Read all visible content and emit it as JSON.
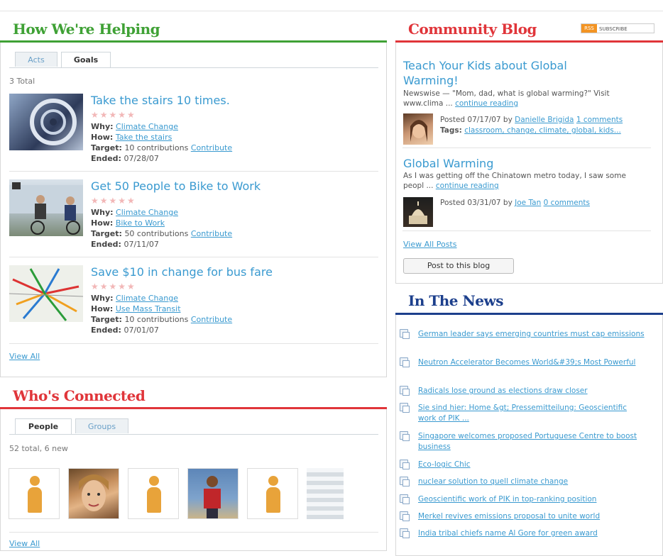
{
  "helping": {
    "heading": "How We're Helping",
    "tabs": [
      {
        "label": "Acts"
      },
      {
        "label": "Goals"
      }
    ],
    "total": "3 Total",
    "goals": [
      {
        "title": "Take the stairs 10 times.",
        "why_label": "Why:",
        "why": "Climate Change",
        "how_label": "How:",
        "how": "Take the stairs",
        "target_label": "Target:",
        "target": "10 contributions",
        "contribute": "Contribute",
        "ended_label": "Ended:",
        "ended": "07/28/07"
      },
      {
        "title": "Get 50 People to Bike to Work",
        "why_label": "Why:",
        "why": "Climate Change",
        "how_label": "How:",
        "how": "Bike to Work",
        "target_label": "Target:",
        "target": "50 contributions",
        "contribute": "Contribute",
        "ended_label": "Ended:",
        "ended": "07/11/07"
      },
      {
        "title": "Save $10 in change for bus fare",
        "why_label": "Why:",
        "why": "Climate Change",
        "how_label": "How:",
        "how": "Use Mass Transit",
        "target_label": "Target:",
        "target": "10 contributions",
        "contribute": "Contribute",
        "ended_label": "Ended:",
        "ended": "07/01/07"
      }
    ],
    "stars": "★★★★★",
    "view_all": "View All"
  },
  "connected": {
    "heading": "Who's Connected",
    "tabs": [
      {
        "label": "People"
      },
      {
        "label": "Groups"
      }
    ],
    "summary": "52 total, 6 new",
    "view_all": "View All"
  },
  "blog": {
    "heading": "Community Blog",
    "subscribe": {
      "badge": "RSS",
      "label": "SUBSCRIBE"
    },
    "posts": [
      {
        "title": "Teach Your Kids about Global Warming!",
        "excerpt": "Newswise — \"Mom, dad, what is global warming?\" Visit www.clima ...",
        "continue": "continue reading",
        "posted": "Posted 07/17/07 by",
        "author": "Danielle Brigida",
        "comments": "1 comments",
        "tags_label": "Tags:",
        "tags": "classroom, change, climate, global, kids..."
      },
      {
        "title": "Global Warming",
        "excerpt": "As I was getting off the Chinatown metro today, I saw some peopl ...",
        "continue": "continue reading",
        "posted": "Posted 03/31/07 by",
        "author": "Joe Tan",
        "comments": "0 comments"
      }
    ],
    "view_all": "View All Posts",
    "post_button": "Post to this blog"
  },
  "news": {
    "heading": "In The News",
    "items": [
      "German leader says emerging countries must cap emissions",
      "Neutron Accelerator Becomes World&#39;s Most Powerful",
      "Radicals lose ground as elections draw closer",
      "Sie sind hier: Home &gt; Pressemitteilung: Geoscientific work of PIK ...",
      "Singapore welcomes proposed Portuguese Centre to boost business",
      "Eco-logic Chic",
      "nuclear solution to quell climate change",
      "Geoscientific work of PIK in top-ranking position",
      "Merkel revives emissions proposal to unite world",
      "India tribal chiefs name Al Gore for green award"
    ]
  },
  "colors": {
    "green": "#3fa135",
    "red": "#e0353a",
    "blue": "#1c3f8c",
    "link": "#3a9ad0"
  }
}
